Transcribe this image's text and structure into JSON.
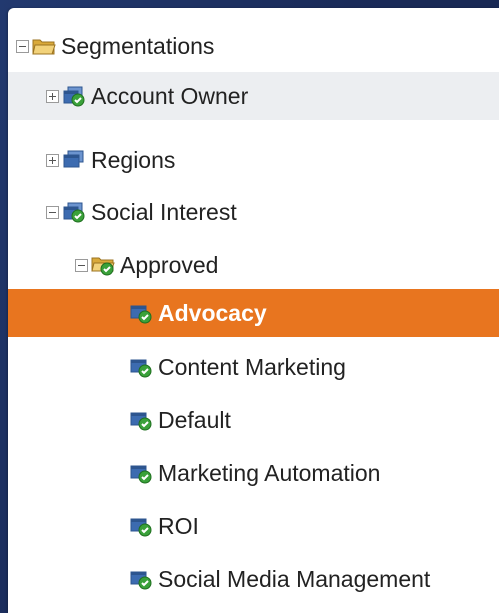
{
  "tree": {
    "root": {
      "label": "Segmentations",
      "state": "expanded",
      "icon": "folder-open-icon"
    },
    "items": [
      {
        "label": "Account Owner",
        "state": "collapsed",
        "icon": "segmentation-approved-icon"
      },
      {
        "label": "Regions",
        "state": "collapsed",
        "icon": "segmentation-draft-icon"
      },
      {
        "label": "Social Interest",
        "state": "expanded",
        "icon": "segmentation-approved-icon"
      },
      {
        "label": "Approved",
        "state": "expanded",
        "icon": "folder-approved-icon"
      },
      {
        "label": "Advocacy",
        "icon": "segment-approved-icon",
        "selected": true
      },
      {
        "label": "Content Marketing",
        "icon": "segment-approved-icon"
      },
      {
        "label": "Default",
        "icon": "segment-approved-icon"
      },
      {
        "label": "Marketing Automation",
        "icon": "segment-approved-icon"
      },
      {
        "label": "ROI",
        "icon": "segment-approved-icon"
      },
      {
        "label": "Social Media Management",
        "icon": "segment-approved-icon"
      }
    ]
  },
  "colors": {
    "selected_bg": "#e8751f",
    "hover_bg": "#eceef1",
    "background": "#1b2d5e",
    "approved_check": "#3aa13a",
    "segment_blue": "#3c6bb0"
  }
}
